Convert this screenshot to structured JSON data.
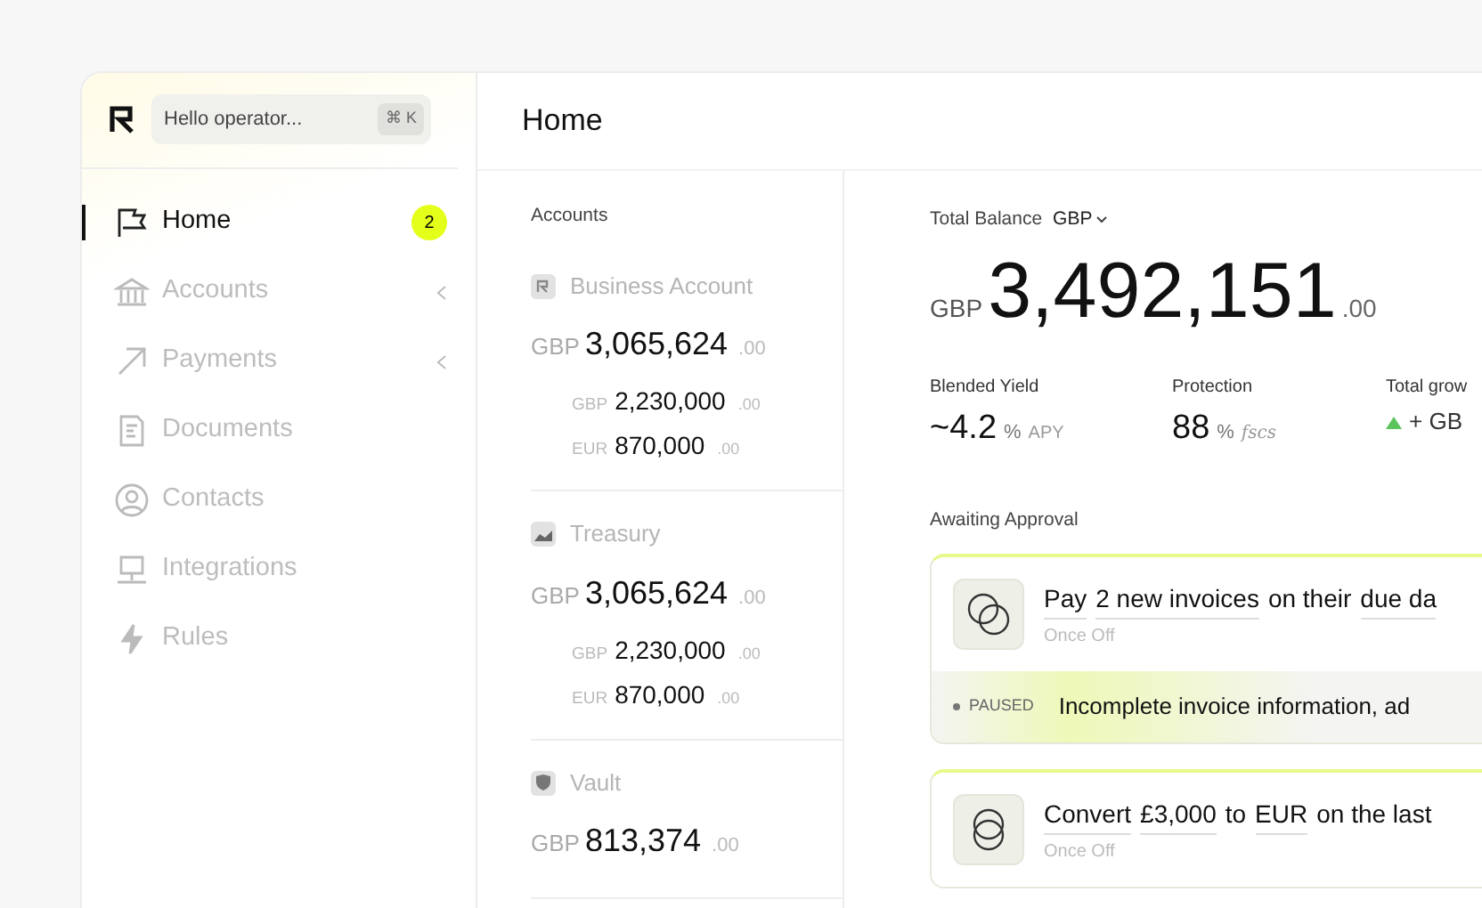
{
  "sidebar": {
    "search": {
      "placeholder": "Hello operator...",
      "shortcut": "⌘ K"
    },
    "nav": [
      {
        "label": "Home",
        "kind": "flag",
        "selected": true,
        "badge": "2",
        "expandable": false
      },
      {
        "label": "Accounts",
        "kind": "bank",
        "selected": false,
        "expandable": true
      },
      {
        "label": "Payments",
        "kind": "arrow",
        "selected": false,
        "expandable": true
      },
      {
        "label": "Documents",
        "kind": "document",
        "selected": false,
        "expandable": false
      },
      {
        "label": "Contacts",
        "kind": "person",
        "selected": false,
        "expandable": false
      },
      {
        "label": "Integrations",
        "kind": "monitor",
        "selected": false,
        "expandable": false
      },
      {
        "label": "Rules",
        "kind": "bolt",
        "selected": false,
        "expandable": false
      }
    ]
  },
  "header": {
    "title": "Home"
  },
  "accounts": {
    "title": "Accounts",
    "items": [
      {
        "name": "Business Account",
        "kind": "logo",
        "currency": "GBP",
        "amount": "3,065,624",
        "cents": ".00",
        "sub": [
          {
            "currency": "GBP",
            "amount": "2,230,000",
            "cents": ".00"
          },
          {
            "currency": "EUR",
            "amount": "870,000",
            "cents": ".00"
          }
        ]
      },
      {
        "name": "Treasury",
        "kind": "chart",
        "currency": "GBP",
        "amount": "3,065,624",
        "cents": ".00",
        "sub": [
          {
            "currency": "GBP",
            "amount": "2,230,000",
            "cents": ".00"
          },
          {
            "currency": "EUR",
            "amount": "870,000",
            "cents": ".00"
          }
        ]
      },
      {
        "name": "Vault",
        "kind": "shield",
        "currency": "GBP",
        "amount": "813,374",
        "cents": ".00"
      }
    ]
  },
  "balance": {
    "label": "Total Balance",
    "currency_select": "GBP",
    "currency": "GBP",
    "amount": "3,492,151",
    "cents": ".00"
  },
  "stats": [
    {
      "label": "Blended Yield",
      "value": "~4.2",
      "unit": "%",
      "suffix": "APY",
      "kind": "plain"
    },
    {
      "label": "Protection",
      "value": "88",
      "unit": "%",
      "suffix": "fscs",
      "kind": "plain"
    },
    {
      "label": "Total grow",
      "value": "+ GB",
      "kind": "growth"
    }
  ],
  "approvals": {
    "title": "Awaiting Approval",
    "items": [
      {
        "kind": "overlap",
        "title": [
          {
            "text": "Pay",
            "underlined": true
          },
          {
            "text": "2 new invoices",
            "underlined": true
          },
          {
            "text": "on their",
            "underlined": false
          },
          {
            "text": "due da",
            "underlined": true
          }
        ],
        "frequency": "Once Off",
        "status": "PAUSED",
        "message": "Incomplete invoice information, ad"
      },
      {
        "kind": "stacked",
        "title": [
          {
            "text": "Convert",
            "underlined": true
          },
          {
            "text": "£3,000",
            "underlined": true
          },
          {
            "text": "to",
            "underlined": false
          },
          {
            "text": "EUR",
            "underlined": true
          },
          {
            "text": "on the last",
            "underlined": false
          }
        ],
        "frequency": "Once Off"
      }
    ]
  }
}
